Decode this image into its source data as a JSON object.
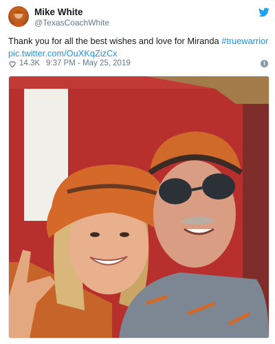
{
  "tweet": {
    "display_name": "Mike White",
    "handle": "@TexasCoachWhite",
    "text": "Thank you for all the best wishes and love for Miranda ",
    "hashtag": "#truewarrior",
    "link": "pic.twitter.com/OuXKqZizCx",
    "likes": "14.3K",
    "timestamp": "9:37 PM - May 25, 2019"
  },
  "icons": {
    "avatar": "profile-photo",
    "brand": "twitter-bird-icon",
    "like": "heart-icon",
    "info": "info-icon"
  },
  "colors": {
    "link": "#1b95e0",
    "brand": "#1da1f2",
    "muted": "#657786"
  }
}
